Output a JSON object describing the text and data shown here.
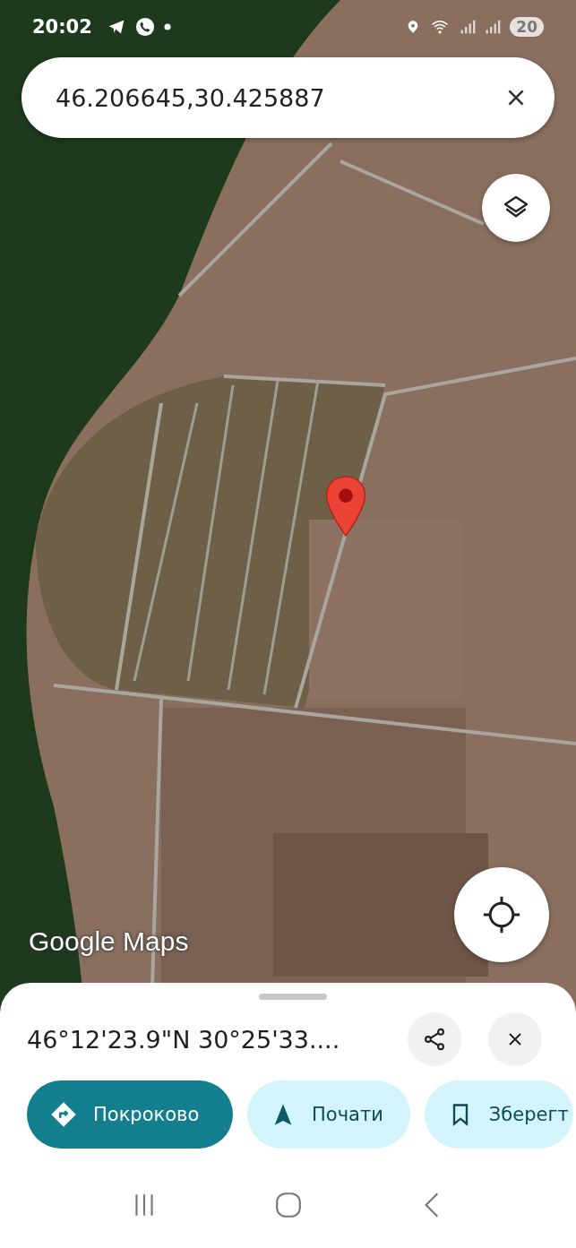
{
  "status_bar": {
    "time": "20:02",
    "battery": "20"
  },
  "search": {
    "value": "46.206645,30.425887"
  },
  "map": {
    "logo": "Google Maps"
  },
  "place": {
    "title": "46°12'23.9\"N 30°25'33...."
  },
  "actions": [
    {
      "kind": "directions",
      "label": "Покроково"
    },
    {
      "kind": "start",
      "label": "Почати"
    },
    {
      "kind": "save",
      "label": "Зберегт"
    }
  ]
}
